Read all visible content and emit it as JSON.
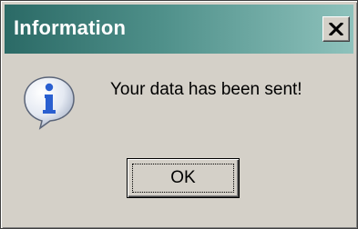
{
  "dialog": {
    "title": "Information",
    "close_icon": "close-icon",
    "icon": "information-icon",
    "message": "Your data has been sent!",
    "ok_label": "OK"
  },
  "colors": {
    "titlebar_start": "#2b6a66",
    "titlebar_end": "#8ec2bc",
    "face": "#d4d0c8",
    "info_icon_fill": "#2a5fd0"
  }
}
